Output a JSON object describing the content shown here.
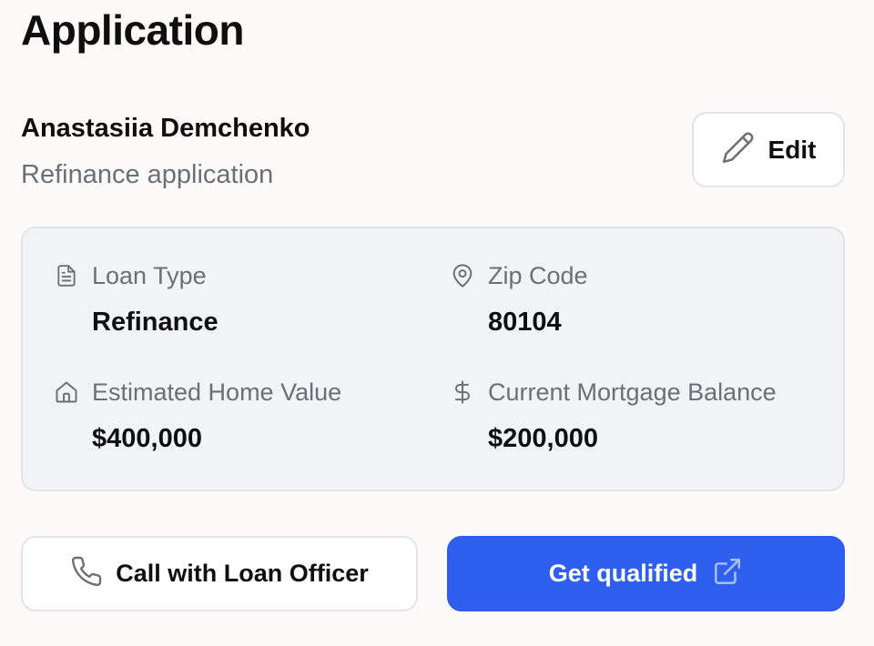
{
  "page": {
    "title": "Application"
  },
  "applicant": {
    "name": "Anastasiia Demchenko",
    "subtitle": "Refinance application"
  },
  "actions": {
    "edit_label": "Edit",
    "call_label": "Call with Loan Officer",
    "qualify_label": "Get qualified"
  },
  "details": {
    "loan_type": {
      "label": "Loan Type",
      "value": "Refinance",
      "icon": "document-icon"
    },
    "zip_code": {
      "label": "Zip Code",
      "value": "80104",
      "icon": "map-pin-icon"
    },
    "home_value": {
      "label": "Estimated Home Value",
      "value": "$400,000",
      "icon": "home-icon"
    },
    "mortgage_balance": {
      "label": "Current Mortgage Balance",
      "value": "$200,000",
      "icon": "dollar-icon"
    }
  },
  "colors": {
    "primary": "#2f5fee",
    "muted_text": "#6b6f78",
    "card_bg": "#f2f3f5",
    "border": "#e3e4e7"
  }
}
